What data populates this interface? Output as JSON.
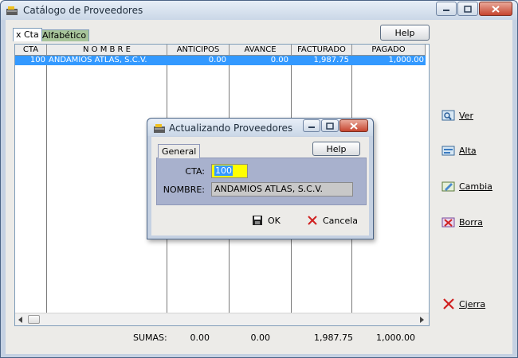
{
  "window": {
    "title": "Catálogo de Proveedores",
    "help_label": "Help"
  },
  "tabs": [
    {
      "label": "x Cta"
    },
    {
      "label": "Alfabético"
    }
  ],
  "grid": {
    "columns": [
      "CTA",
      "N O M B R E",
      "ANTICIPOS",
      "AVANCE",
      "FACTURADO",
      "PAGADO"
    ],
    "rows": [
      {
        "cta": "100",
        "nombre": "ANDAMIOS ATLAS, S.C.V.",
        "anticipos": "0.00",
        "avance": "0.00",
        "facturado": "1,987.75",
        "pagado": "1,000.00"
      }
    ]
  },
  "actions": [
    {
      "label": "Ver",
      "icon": "view-icon"
    },
    {
      "label": "Alta",
      "icon": "add-icon"
    },
    {
      "label": "Cambia",
      "icon": "edit-icon"
    },
    {
      "label": "Borra",
      "icon": "delete-icon"
    },
    {
      "label": "Cjerra",
      "icon": "close-x-icon"
    }
  ],
  "totals": {
    "label": "SUMAS:",
    "anticipos": "0.00",
    "avance": "0.00",
    "facturado": "1,987.75",
    "pagado": "1,000.00"
  },
  "dialog": {
    "title": "Actualizando Proveedores",
    "tab_label": "General",
    "help_label": "Help",
    "cta_label": "CTA:",
    "cta_value": "100",
    "nombre_label": "NOMBRE:",
    "nombre_value": "ANDAMIOS ATLAS, S.C.V.",
    "ok_label": "OK",
    "cancel_label": "Cancela"
  },
  "colors": {
    "selection": "#3399ff",
    "cta_field_bg": "#ffff00",
    "inactive_tab": "#a7c49a"
  }
}
